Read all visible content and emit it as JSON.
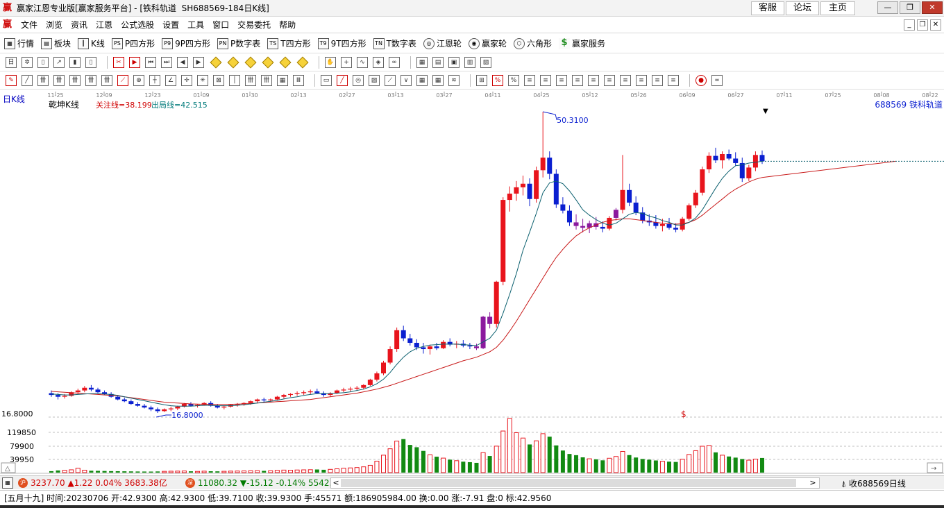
{
  "window": {
    "title": "赢家江恩专业版[赢家服务平台] - [铁科轨道  SH688569-184日K线]",
    "links": [
      "客服",
      "论坛",
      "主页"
    ],
    "controls": [
      "—",
      "❐",
      "✕"
    ]
  },
  "menu": [
    "文件",
    "浏览",
    "资讯",
    "江恩",
    "公式选股",
    "设置",
    "工具",
    "窗口",
    "交易委托",
    "帮助"
  ],
  "toolbar": [
    {
      "label": "行情",
      "icon": "grid-icon"
    },
    {
      "label": "板块",
      "icon": "sector-icon"
    },
    {
      "label": "K线",
      "icon": "kline-icon"
    },
    {
      "label": "P四方形",
      "icon": "ps-icon"
    },
    {
      "label": "9P四方形",
      "icon": "p9-icon"
    },
    {
      "label": "P数字表",
      "icon": "pn-icon"
    },
    {
      "label": "T四方形",
      "icon": "ts-icon"
    },
    {
      "label": "9T四方形",
      "icon": "t9-icon"
    },
    {
      "label": "T数字表",
      "icon": "tn-icon"
    },
    {
      "label": "江恩轮",
      "icon": "wheel-icon"
    },
    {
      "label": "赢家轮",
      "icon": "wheel2-icon"
    },
    {
      "label": "六角形",
      "icon": "hexagon-icon"
    },
    {
      "label": "赢家服务",
      "icon": "dollar-icon"
    }
  ],
  "chart": {
    "period_label": "日K线",
    "indicator_name": "乾坤K线",
    "focus_line": "关注线=38.199",
    "exit_line": "出局线=42.515",
    "stock_label": "688569  铁科轨道",
    "high_marker": "50.3100",
    "low_marker": "16.8000",
    "dollar_marker": "$",
    "date_ticks": [
      "11-25",
      "12-09",
      "12-23",
      "01-09",
      "01-30",
      "02-13",
      "02-27",
      "03-13",
      "03-27",
      "04-11",
      "04-25",
      "05-12",
      "05-26",
      "06-09",
      "06-27",
      "07-11",
      "07-25",
      "08-08",
      "08-22"
    ],
    "price_axis_label": "16.8000",
    "volume_ticks": [
      "119850",
      "79900",
      "39950"
    ],
    "colors": {
      "up": "#e8141c",
      "down": "#0a1fd0",
      "purple": "#8b1a9e",
      "vol_up": "#e8141c",
      "vol_down": "#128a12",
      "ma_short": "#0a5f6e",
      "ma_long": "#c81818"
    }
  },
  "chart_data": {
    "type": "candlestick",
    "title": "乾坤K线",
    "subtitle": "688569 铁科轨道",
    "xlabel": "",
    "ylabel": "",
    "ylim": [
      16.8,
      50.31
    ],
    "annotations": [
      "关注线=38.199",
      "出局线=42.515",
      "50.3100",
      "16.8000"
    ],
    "ohlc": [
      [
        19.0,
        19.3,
        18.6,
        18.8
      ],
      [
        18.8,
        19.0,
        18.3,
        18.6
      ],
      [
        18.6,
        18.9,
        18.4,
        18.7
      ],
      [
        18.7,
        19.2,
        18.6,
        19.1
      ],
      [
        19.1,
        19.5,
        18.9,
        19.3
      ],
      [
        19.3,
        19.8,
        19.1,
        19.6
      ],
      [
        19.6,
        19.9,
        19.2,
        19.4
      ],
      [
        19.4,
        19.6,
        19.0,
        19.1
      ],
      [
        19.1,
        19.3,
        18.8,
        18.9
      ],
      [
        18.9,
        19.1,
        18.5,
        18.6
      ],
      [
        18.6,
        18.8,
        18.2,
        18.3
      ],
      [
        18.3,
        18.5,
        18.0,
        18.1
      ],
      [
        18.1,
        18.3,
        17.7,
        17.8
      ],
      [
        17.8,
        18.0,
        17.5,
        17.6
      ],
      [
        17.6,
        17.8,
        17.3,
        17.4
      ],
      [
        17.4,
        17.6,
        17.0,
        17.2
      ],
      [
        17.2,
        17.4,
        16.8,
        17.0
      ],
      [
        17.0,
        17.3,
        16.9,
        17.2
      ],
      [
        17.2,
        17.5,
        17.0,
        17.3
      ],
      [
        17.3,
        17.6,
        17.1,
        17.5
      ],
      [
        17.5,
        17.9,
        17.4,
        17.8
      ],
      [
        17.8,
        18.0,
        17.5,
        17.6
      ],
      [
        17.6,
        17.8,
        17.4,
        17.7
      ],
      [
        17.7,
        18.0,
        17.6,
        17.9
      ],
      [
        17.9,
        18.1,
        17.5,
        17.6
      ],
      [
        17.6,
        17.8,
        17.3,
        17.4
      ],
      [
        17.4,
        17.6,
        17.2,
        17.5
      ],
      [
        17.5,
        17.8,
        17.4,
        17.7
      ],
      [
        17.7,
        17.9,
        17.5,
        17.8
      ],
      [
        17.8,
        18.0,
        17.6,
        17.9
      ],
      [
        17.9,
        18.2,
        17.7,
        18.1
      ],
      [
        18.1,
        18.4,
        17.9,
        18.3
      ],
      [
        18.3,
        18.5,
        18.0,
        18.2
      ],
      [
        18.2,
        18.4,
        18.0,
        18.3
      ],
      [
        18.3,
        18.7,
        18.2,
        18.6
      ],
      [
        18.6,
        18.9,
        18.4,
        18.8
      ],
      [
        18.8,
        19.0,
        18.6,
        18.9
      ],
      [
        18.9,
        19.2,
        18.7,
        19.0
      ],
      [
        19.0,
        19.3,
        18.8,
        19.1
      ],
      [
        19.1,
        19.4,
        18.9,
        19.2
      ],
      [
        19.2,
        19.5,
        18.9,
        19.0
      ],
      [
        19.0,
        19.2,
        18.6,
        18.8
      ],
      [
        18.8,
        19.1,
        18.6,
        19.0
      ],
      [
        19.0,
        19.4,
        18.9,
        19.3
      ],
      [
        19.3,
        19.6,
        19.1,
        19.4
      ],
      [
        19.4,
        19.7,
        19.2,
        19.5
      ],
      [
        19.5,
        19.8,
        19.3,
        19.6
      ],
      [
        19.6,
        20.0,
        19.4,
        19.9
      ],
      [
        19.9,
        20.6,
        19.8,
        20.5
      ],
      [
        20.5,
        21.4,
        20.3,
        21.2
      ],
      [
        21.2,
        22.6,
        21.0,
        22.4
      ],
      [
        22.4,
        24.2,
        22.2,
        23.9
      ],
      [
        23.9,
        26.3,
        23.6,
        26.0
      ],
      [
        26.0,
        26.5,
        24.8,
        25.1
      ],
      [
        25.1,
        25.6,
        24.3,
        24.6
      ],
      [
        24.6,
        25.0,
        23.8,
        24.1
      ],
      [
        24.1,
        24.6,
        23.4,
        23.9
      ],
      [
        23.9,
        24.4,
        23.3,
        24.2
      ],
      [
        24.2,
        24.6,
        23.8,
        24.0
      ],
      [
        24.0,
        24.9,
        23.9,
        24.7
      ],
      [
        24.7,
        25.1,
        24.2,
        24.4
      ],
      [
        24.4,
        24.8,
        24.0,
        24.5
      ],
      [
        24.5,
        24.9,
        24.1,
        24.3
      ],
      [
        24.3,
        24.6,
        23.9,
        24.2
      ],
      [
        24.2,
        24.5,
        23.8,
        24.0
      ],
      [
        24.0,
        27.6,
        23.9,
        27.5
      ],
      [
        27.5,
        28.0,
        26.2,
        26.7
      ],
      [
        26.7,
        31.5,
        26.3,
        31.4
      ],
      [
        31.4,
        40.8,
        31.0,
        40.5
      ],
      [
        40.5,
        42.0,
        39.2,
        41.2
      ],
      [
        41.2,
        42.6,
        40.4,
        41.9
      ],
      [
        41.9,
        43.2,
        41.0,
        42.3
      ],
      [
        42.3,
        42.9,
        39.8,
        40.6
      ],
      [
        40.6,
        44.2,
        40.2,
        43.8
      ],
      [
        43.8,
        50.31,
        43.0,
        45.2
      ],
      [
        45.2,
        45.9,
        42.8,
        43.4
      ],
      [
        43.4,
        43.9,
        39.6,
        40.0
      ],
      [
        40.0,
        40.8,
        39.0,
        39.3
      ],
      [
        39.3,
        39.9,
        37.6,
        38.0
      ],
      [
        38.0,
        38.9,
        37.2,
        37.6
      ],
      [
        37.6,
        38.4,
        36.9,
        37.4
      ],
      [
        37.4,
        38.2,
        36.8,
        37.9
      ],
      [
        37.9,
        38.6,
        37.2,
        37.5
      ],
      [
        37.5,
        38.1,
        36.9,
        37.3
      ],
      [
        37.3,
        38.7,
        37.1,
        38.5
      ],
      [
        38.5,
        39.6,
        38.2,
        39.4
      ],
      [
        39.4,
        45.5,
        39.0,
        41.6
      ],
      [
        41.6,
        42.3,
        39.8,
        40.2
      ],
      [
        40.2,
        40.9,
        38.8,
        39.1
      ],
      [
        39.1,
        39.7,
        37.9,
        38.2
      ],
      [
        38.2,
        38.9,
        37.6,
        38.0
      ],
      [
        38.0,
        38.8,
        37.3,
        37.6
      ],
      [
        37.6,
        38.4,
        37.0,
        37.8
      ],
      [
        37.8,
        38.5,
        37.2,
        37.4
      ],
      [
        37.4,
        37.9,
        36.9,
        37.2
      ],
      [
        37.2,
        38.6,
        37.0,
        38.4
      ],
      [
        38.4,
        40.1,
        38.2,
        39.9
      ],
      [
        39.9,
        41.6,
        39.6,
        41.3
      ],
      [
        41.3,
        44.2,
        41.0,
        43.9
      ],
      [
        43.9,
        45.8,
        43.5,
        45.4
      ],
      [
        45.4,
        46.3,
        44.6,
        44.9
      ],
      [
        44.9,
        45.9,
        44.0,
        45.6
      ],
      [
        45.6,
        46.1,
        44.9,
        45.1
      ],
      [
        45.1,
        45.8,
        44.3,
        44.6
      ],
      [
        44.6,
        45.2,
        42.5,
        42.9
      ],
      [
        42.9,
        44.4,
        42.6,
        44.1
      ],
      [
        44.1,
        45.9,
        43.7,
        45.5
      ],
      [
        45.5,
        46.0,
        44.5,
        44.8
      ]
    ],
    "volume": [
      3200,
      4800,
      5100,
      6200,
      9800,
      5400,
      4100,
      3900,
      3600,
      3300,
      3100,
      2900,
      2700,
      2500,
      2400,
      2300,
      2600,
      2800,
      3100,
      3300,
      3600,
      2900,
      2700,
      3200,
      3000,
      2800,
      2900,
      3300,
      3500,
      3700,
      4100,
      4400,
      3900,
      4200,
      5100,
      5600,
      5300,
      5800,
      6100,
      6400,
      6900,
      6300,
      7200,
      8400,
      9800,
      10400,
      11200,
      12800,
      16200,
      25400,
      38600,
      52800,
      69800,
      74200,
      61300,
      56200,
      48100,
      39600,
      35200,
      32100,
      28600,
      26400,
      24200,
      23100,
      21600,
      44200,
      36800,
      58600,
      92100,
      119850,
      88400,
      76500,
      62300,
      70400,
      86200,
      79500,
      60200,
      48900,
      41300,
      38600,
      33800,
      30600,
      29400,
      27200,
      31800,
      35700,
      46900,
      38800,
      33400,
      30200,
      28600,
      26900,
      25100,
      24300,
      23600,
      29600,
      40100,
      48500,
      58400,
      60200,
      44800,
      38600,
      35700,
      33200,
      30100,
      27600,
      29900,
      32400
    ],
    "ma_short": [
      18.9,
      18.85,
      18.8,
      18.8,
      18.85,
      18.9,
      18.95,
      18.95,
      18.9,
      18.85,
      18.75,
      18.6,
      18.45,
      18.3,
      18.15,
      18.0,
      17.85,
      17.7,
      17.6,
      17.55,
      17.55,
      17.55,
      17.6,
      17.65,
      17.65,
      17.6,
      17.6,
      17.6,
      17.65,
      17.7,
      17.8,
      17.9,
      18.0,
      18.1,
      18.2,
      18.35,
      18.5,
      18.6,
      18.75,
      18.85,
      18.95,
      18.95,
      18.95,
      19.0,
      19.05,
      19.15,
      19.3,
      19.45,
      19.7,
      20.05,
      20.55,
      21.3,
      22.2,
      23.0,
      23.6,
      24.0,
      24.2,
      24.35,
      24.4,
      24.45,
      24.45,
      24.45,
      24.4,
      24.35,
      24.3,
      24.7,
      25.1,
      26.0,
      27.9,
      30.0,
      32.3,
      34.9,
      36.9,
      39.0,
      41.3,
      42.4,
      42.6,
      42.3,
      41.5,
      40.5,
      39.4,
      38.8,
      38.3,
      37.9,
      37.7,
      37.9,
      38.4,
      38.9,
      39.1,
      39.0,
      38.7,
      38.5,
      38.2,
      38.0,
      37.7,
      37.7,
      38.0,
      38.5,
      39.4,
      40.6,
      41.8,
      42.9,
      43.7,
      44.3,
      44.4,
      44.6,
      44.7,
      44.8
    ],
    "ma_long": [
      19.2,
      19.15,
      19.1,
      19.05,
      19.0,
      18.95,
      18.9,
      18.85,
      18.8,
      18.75,
      18.7,
      18.6,
      18.5,
      18.4,
      18.3,
      18.2,
      18.1,
      18.0,
      17.95,
      17.9,
      17.85,
      17.8,
      17.78,
      17.76,
      17.75,
      17.75,
      17.75,
      17.76,
      17.78,
      17.8,
      17.85,
      17.9,
      17.95,
      18.0,
      18.05,
      18.1,
      18.15,
      18.2,
      18.25,
      18.3,
      18.4,
      18.5,
      18.6,
      18.7,
      18.8,
      18.9,
      19.0,
      19.15,
      19.3,
      19.45,
      19.65,
      19.85,
      20.1,
      20.35,
      20.6,
      20.85,
      21.1,
      21.35,
      21.6,
      21.85,
      22.1,
      22.35,
      22.6,
      22.8,
      23.0,
      23.3,
      23.6,
      24.1,
      24.9,
      25.9,
      27.0,
      28.2,
      29.4,
      30.6,
      31.8,
      33.0,
      34.1,
      35.0,
      35.8,
      36.5,
      37.0,
      37.4,
      37.7,
      38.0,
      38.2,
      38.3,
      38.4,
      38.4,
      38.3,
      38.2,
      38.1,
      38.0,
      37.9,
      37.85,
      37.8,
      37.85,
      38.0,
      38.3,
      38.8,
      39.4,
      40.0,
      40.6,
      41.2,
      41.7,
      42.1,
      42.5,
      42.8,
      43.0
    ]
  },
  "status": {
    "sh_badge": "沪",
    "sh_value": "3237.70",
    "sh_change": "▲1.22",
    "sh_pct": "0.04%",
    "sh_amount": "3683.38亿",
    "sz_badge": "深",
    "sz_value": "11080.32",
    "sz_change": "▼-15.12",
    "sz_pct": "-0.14%",
    "sz_amount": "5542.38",
    "right_text": "收688569日线",
    "scroll_left": "<",
    "scroll_right": ">"
  },
  "info": "[五月十九] 时间:20230706 开:42.9300 高:42.9300 低:39.7100 收:39.9300 手:45571 额:186905984.00 换:0.00 涨:-7.91 盘:0 标:42.9560"
}
